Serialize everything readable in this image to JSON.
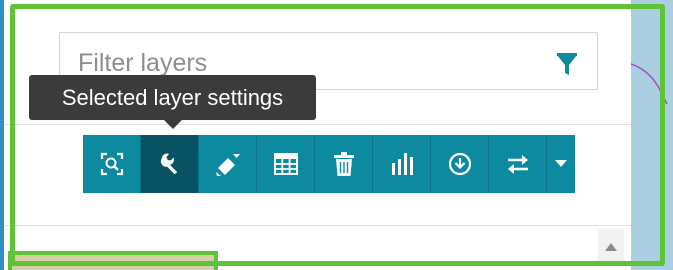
{
  "filter": {
    "placeholder": "Filter layers"
  },
  "tooltip": {
    "text": "Selected layer settings"
  },
  "toolbar": {
    "active_index": 1,
    "buttons": [
      {
        "icon": "zoom-to-layer-icon"
      },
      {
        "icon": "wrench-icon"
      },
      {
        "icon": "paint-brush-icon"
      },
      {
        "icon": "table-icon"
      },
      {
        "icon": "trash-icon"
      },
      {
        "icon": "bar-chart-icon"
      },
      {
        "icon": "download-icon"
      },
      {
        "icon": "swap-arrows-icon"
      },
      {
        "icon": "caret-down-icon"
      }
    ]
  },
  "colors": {
    "toolbar_bg": "#0e8aa0",
    "toolbar_active": "#075363",
    "tooltip_bg": "#3b3b3b",
    "highlight_frame": "#5fc33a",
    "accent": "#0e8aa0"
  }
}
